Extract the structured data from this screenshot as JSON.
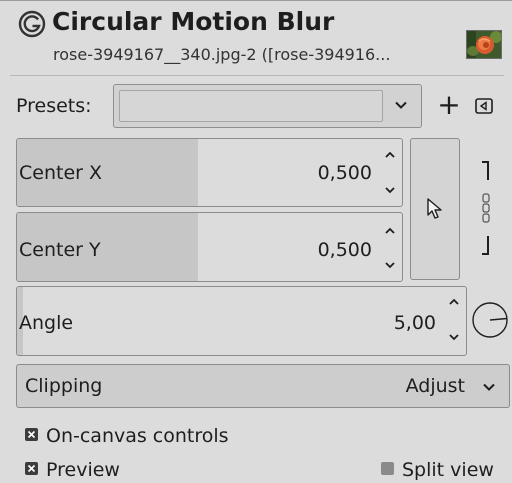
{
  "header": {
    "title": "Circular Motion Blur",
    "subtitle": "rose-3949167__340.jpg-2 ([rose-394916..."
  },
  "presets": {
    "label": "Presets:",
    "value": "",
    "add_symbol": "+"
  },
  "center_x": {
    "label": "Center X",
    "value": "0,500",
    "fill_fraction": 0.5
  },
  "center_y": {
    "label": "Center Y",
    "value": "0,500",
    "fill_fraction": 0.5
  },
  "angle": {
    "label": "Angle",
    "value": "5,00",
    "fill_fraction": 0.014
  },
  "clipping": {
    "label": "Clipping",
    "value": "Adjust"
  },
  "checkboxes": {
    "on_canvas": {
      "label": "On-canvas controls",
      "checked": true
    },
    "preview": {
      "label": "Preview",
      "checked": true
    },
    "split_view": {
      "label": "Split view",
      "checked": false
    }
  },
  "icons": {
    "filter": "gimp-filter-icon",
    "thumbnail": "rose-image-thumbnail",
    "presets_menu": "menu-icon",
    "picker": "pointer-icon",
    "chain": "chain-link-icon",
    "dial": "angle-dial-icon"
  },
  "colors": {
    "background": "#dcdcdc",
    "field_fill": "#c6c6c6",
    "border": "#8c8c8c"
  }
}
